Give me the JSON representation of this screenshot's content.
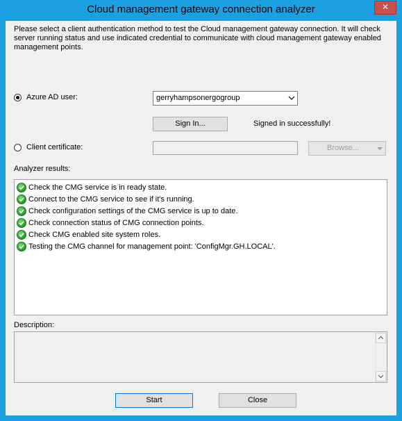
{
  "window": {
    "title": "Cloud management gateway connection analyzer",
    "close_glyph": "✕"
  },
  "intro_text": "Please select a client authentication method to test the Cloud management gateway connection. It will check server running status and use indicated credential to communicate with cloud management gateway enabled management points.",
  "azure_ad": {
    "label": "Azure AD user:",
    "selected": true,
    "user_value": "gerryhampsonergogroup",
    "sign_in_label": "Sign In...",
    "status": "Signed in successfully!"
  },
  "client_cert": {
    "label": "Client certificate:",
    "selected": false,
    "value": "",
    "browse_label": "Browse..."
  },
  "results": {
    "label": "Analyzer results:",
    "items": [
      "Check the CMG service is in ready state.",
      "Connect to the CMG service to see if it's running.",
      "Check configuration settings of the CMG service is up to date.",
      "Check connection status of CMG connection points.",
      "Check CMG enabled site system roles.",
      "Testing the CMG channel for management point: 'ConfigMgr.GH.LOCAL'."
    ],
    "icon": "check-circle-icon",
    "icon_color": "#1f9a1f"
  },
  "description": {
    "label": "Description:",
    "text": ""
  },
  "footer": {
    "start_label": "Start",
    "close_label": "Close"
  },
  "colors": {
    "titlebar": "#1ba1e2",
    "close_button": "#c7504b",
    "dialog_background": "#f0f0f0"
  }
}
